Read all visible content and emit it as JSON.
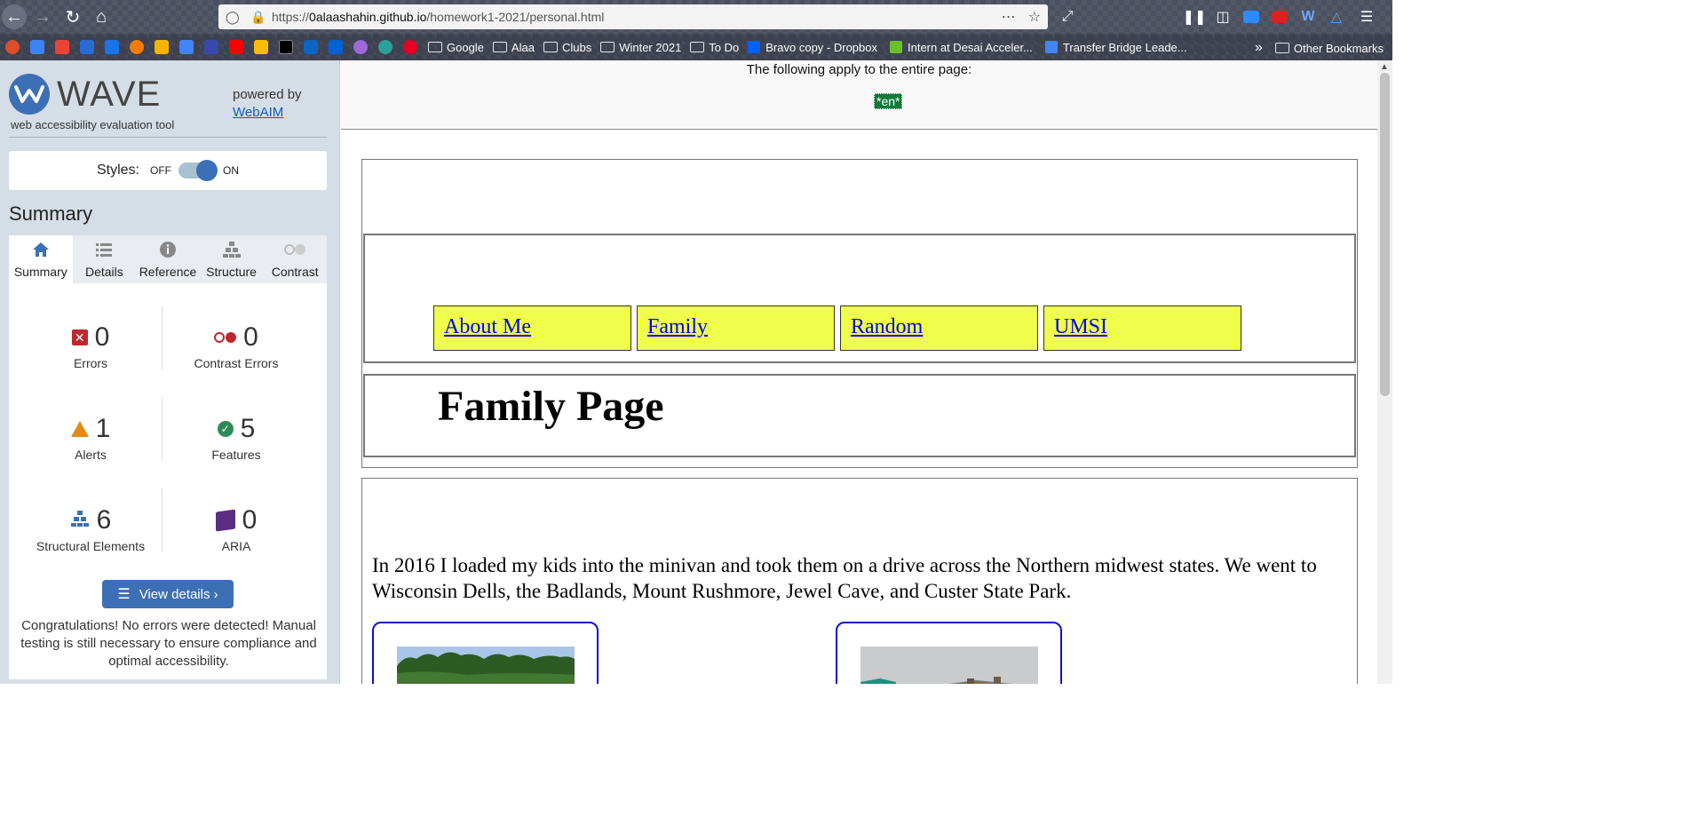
{
  "browser": {
    "url_prefix": "https://",
    "url_host": "0alaashahin.github.io",
    "url_path": "/homework1-2021/personal.html",
    "bookmarks": [
      {
        "label": "Google",
        "kind": "folder"
      },
      {
        "label": "Alaa",
        "kind": "folder"
      },
      {
        "label": "Clubs",
        "kind": "folder"
      },
      {
        "label": "Winter 2021",
        "kind": "folder"
      },
      {
        "label": "To Do",
        "kind": "folder"
      },
      {
        "label": "Bravo copy - Dropbox",
        "kind": "link"
      },
      {
        "label": "Intern at Desai Acceler...",
        "kind": "link"
      },
      {
        "label": "Transfer Bridge Leade...",
        "kind": "link"
      }
    ],
    "other_bookmarks": "Other Bookmarks",
    "favicon_colors": [
      "#d9502a",
      "#3b82f6",
      "#ea4335",
      "#2b6cd4",
      "#1a73e8",
      "#f57c00",
      "#f4b400",
      "#4285f4",
      "#3949ab",
      "#ff0000",
      "#fbbc04",
      "#000000",
      "#0a66c2",
      "#0061d5",
      "#9c6ad9",
      "#2aa198",
      "#e60023"
    ]
  },
  "wave": {
    "logo_word": "WAVE",
    "tagline": "web accessibility evaluation tool",
    "powered_by": "powered by",
    "webaim_link": "WebAIM",
    "styles_label": "Styles:",
    "styles_off": "OFF",
    "styles_on": "ON",
    "styles_state": "on",
    "summary_heading": "Summary",
    "tabs": [
      {
        "label": "Summary",
        "icon": "home-icon"
      },
      {
        "label": "Details",
        "icon": "list-icon"
      },
      {
        "label": "Reference",
        "icon": "info-icon"
      },
      {
        "label": "Structure",
        "icon": "structure-icon"
      },
      {
        "label": "Contrast",
        "icon": "contrast-icon"
      }
    ],
    "stats": {
      "errors": {
        "count": "0",
        "label": "Errors"
      },
      "contrast_errors": {
        "count": "0",
        "label": "Contrast Errors"
      },
      "alerts": {
        "count": "1",
        "label": "Alerts"
      },
      "features": {
        "count": "5",
        "label": "Features"
      },
      "structural": {
        "count": "6",
        "label": "Structural Elements"
      },
      "aria": {
        "count": "0",
        "label": "ARIA"
      }
    },
    "view_details": "View details ›",
    "congrats": "Congratulations! No errors were detected! Manual testing is still necessary to ensure compliance and optimal accessibility."
  },
  "page": {
    "lang_note": "The following apply to the entire page:",
    "lang_tag": "*en*",
    "nav": [
      "About Me",
      "Family",
      "Random",
      "UMSI"
    ],
    "heading": "Family Page",
    "paragraph": "In 2016 I loaded my kids into the minivan and took them on a drive across the Northern midwest states. We went to Wisconsin Dells, the Badlands, Mount Rushmore, Jewel Cave, and Custer State Park."
  },
  "colors": {
    "accent": "#3d6fb6",
    "nav_bg": "#eefe4a",
    "lang_tag_bg": "#117a3a",
    "error": "#c0272d",
    "alert": "#e38a13",
    "feature": "#2e8b57",
    "aria": "#5a2d82"
  }
}
